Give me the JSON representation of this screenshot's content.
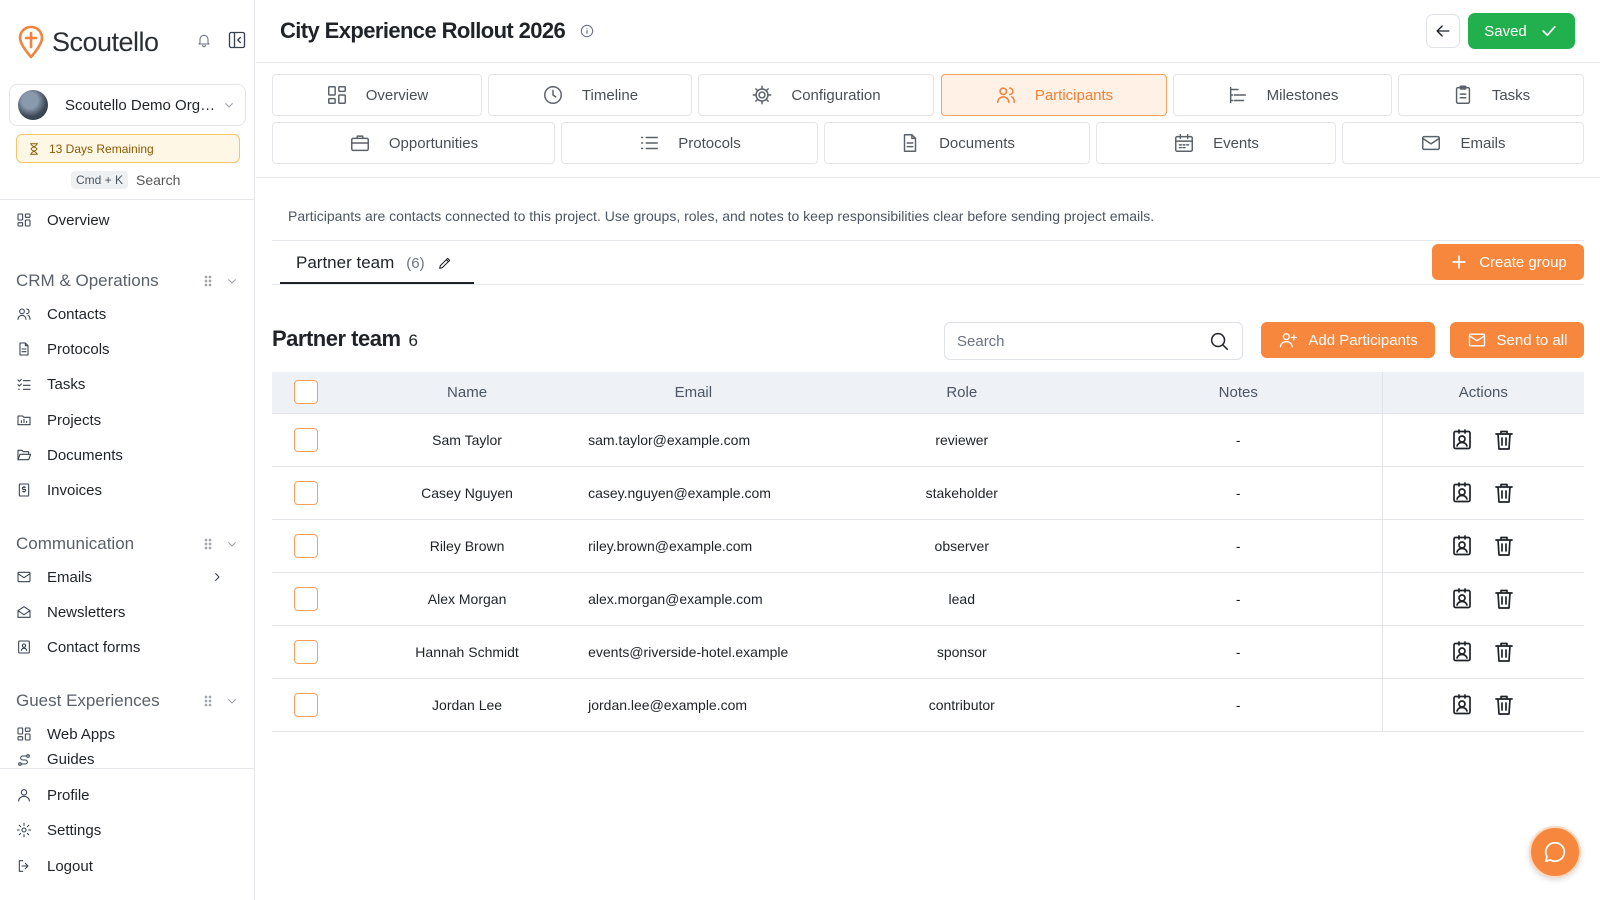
{
  "app": {
    "name": "Scoutello"
  },
  "sidebar": {
    "org_name": "Scoutello Demo Organization",
    "trial_text": "13 Days Remaining",
    "search_shortcut": "Cmd + K",
    "search_label": "Search",
    "overview_label": "Overview",
    "sections": [
      {
        "title": "CRM & Operations",
        "items": [
          {
            "label": "Contacts",
            "icon": "users-icon"
          },
          {
            "label": "Protocols",
            "icon": "file-icon"
          },
          {
            "label": "Tasks",
            "icon": "checklist-icon"
          },
          {
            "label": "Projects",
            "icon": "folder-icon"
          },
          {
            "label": "Documents",
            "icon": "folder-open-icon"
          },
          {
            "label": "Invoices",
            "icon": "invoice-icon"
          }
        ]
      },
      {
        "title": "Communication",
        "items": [
          {
            "label": "Emails",
            "icon": "mail-icon"
          },
          {
            "label": "Newsletters",
            "icon": "mail-open-icon"
          },
          {
            "label": "Contact forms",
            "icon": "form-icon"
          }
        ]
      },
      {
        "title": "Guest Experiences",
        "items": [
          {
            "label": "Web Apps",
            "icon": "grid-icon"
          },
          {
            "label": "Guides",
            "icon": "route-icon"
          }
        ]
      }
    ],
    "bottom": [
      {
        "label": "Profile",
        "icon": "user-icon"
      },
      {
        "label": "Settings",
        "icon": "gear-icon"
      },
      {
        "label": "Logout",
        "icon": "logout-icon"
      }
    ]
  },
  "header": {
    "title": "City Experience Rollout 2026",
    "saved_label": "Saved"
  },
  "tabs": {
    "row1": [
      "Overview",
      "Timeline",
      "Configuration",
      "Participants",
      "Milestones",
      "Tasks"
    ],
    "row2": [
      "Opportunities",
      "Protocols",
      "Documents",
      "Events",
      "Emails"
    ],
    "active": "Participants"
  },
  "participants": {
    "description": "Participants are contacts connected to this project. Use groups, roles, and notes to keep responsibilities clear before sending project emails.",
    "group_tab_label": "Partner team",
    "group_tab_count": "(6)",
    "create_group_label": "Create group",
    "table_title": "Partner team",
    "table_count": "6",
    "search_placeholder": "Search",
    "add_label": "Add Participants",
    "send_label": "Send to all",
    "columns": {
      "name": "Name",
      "email": "Email",
      "role": "Role",
      "notes": "Notes",
      "actions": "Actions"
    },
    "rows": [
      {
        "name": "Sam Taylor",
        "email": "sam.taylor@example.com",
        "role": "reviewer",
        "notes": "-"
      },
      {
        "name": "Casey Nguyen",
        "email": "casey.nguyen@example.com",
        "role": "stakeholder",
        "notes": "-"
      },
      {
        "name": "Riley Brown",
        "email": "riley.brown@example.com",
        "role": "observer",
        "notes": "-"
      },
      {
        "name": "Alex Morgan",
        "email": "alex.morgan@example.com",
        "role": "lead",
        "notes": "-"
      },
      {
        "name": "Hannah Schmidt",
        "email": "events@riverside-hotel.example",
        "role": "sponsor",
        "notes": "-"
      },
      {
        "name": "Jordan Lee",
        "email": "jordan.lee@example.com",
        "role": "contributor",
        "notes": "-"
      }
    ]
  },
  "colors": {
    "accent": "#f8873e",
    "success": "#22b04f",
    "active_tab_bg": "#fff1e6"
  }
}
